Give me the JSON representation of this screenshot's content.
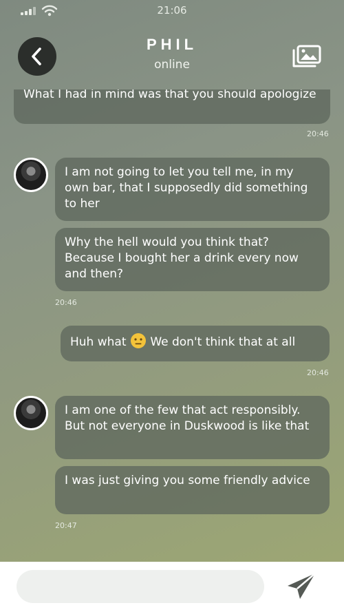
{
  "status_bar": {
    "time": "21:06",
    "signal_icon": "signal-bars-icon",
    "wifi_icon": "wifi-icon"
  },
  "header": {
    "back_icon": "chevron-left-icon",
    "contact_name": "PHIL",
    "contact_status": "online",
    "gallery_icon": "gallery-icon"
  },
  "messages": [
    {
      "sender": "me",
      "text": "What I had in mind was that you should apologize"
    },
    {
      "sender": "me",
      "time": "20:46"
    },
    {
      "sender": "phil",
      "text": "I am not going to let you tell me, in my own bar, that I supposedly did something to her"
    },
    {
      "sender": "phil",
      "text": "Why the hell would you think that? Because I bought her a drink every now and then?",
      "time": "20:46"
    },
    {
      "sender": "me",
      "text_before": "Huh what",
      "emoji": "neutral-face-emoji",
      "text_after": "We don't think that at all",
      "time": "20:46"
    },
    {
      "sender": "phil",
      "text": "I am one of the few that act responsibly. But not everyone in Duskwood is like that"
    },
    {
      "sender": "phil",
      "text": "I was just giving you some friendly advice",
      "time": "20:47"
    }
  ],
  "input": {
    "placeholder": "",
    "send_icon": "send-icon"
  },
  "colors": {
    "bubble": "#5f685e",
    "back_button": "#2b2e2b",
    "input_bar": "#ffffff",
    "send_icon": "#555a55"
  }
}
